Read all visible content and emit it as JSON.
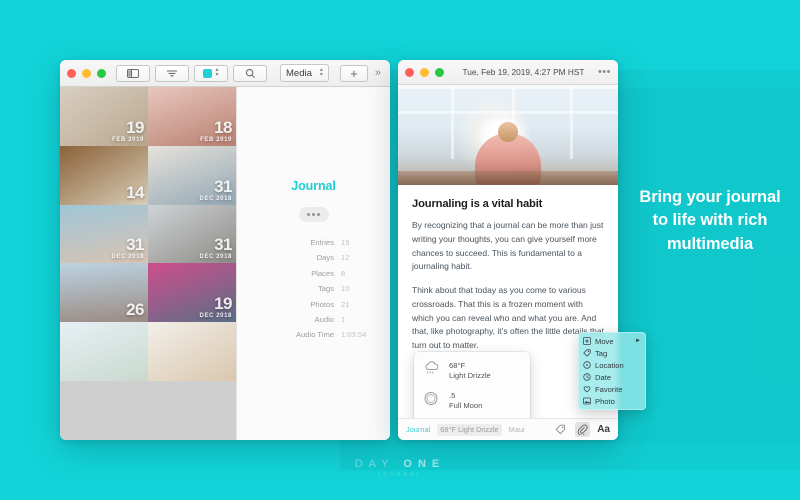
{
  "backdrop": {
    "accent_color": "#12d4d8",
    "marketing_text": "Bring your journal to life with rich multimedia",
    "watermark_main": "DAY ONE",
    "watermark_sub": "JOURNAL"
  },
  "media_window": {
    "toolbar": {
      "sidebar_toggle_icon": "sidebar-toggle-icon",
      "filter_icon": "filter-icon",
      "color_swatch_color": "#22cfd4",
      "search_icon": "search-icon",
      "select_value": "Media",
      "add_label": "+",
      "overflow_label": "»"
    },
    "grid_tiles": [
      {
        "day": "19",
        "month": "FEB 2019",
        "show_badge": true,
        "bg": "linear-gradient(145deg,#d8cfc0,#b9a78e)"
      },
      {
        "day": "18",
        "month": "FEB 2019",
        "show_badge": true,
        "bg": "linear-gradient(160deg,#e8c7bd,#b98071)"
      },
      {
        "day": "14",
        "month": "",
        "show_badge": true,
        "bg": "linear-gradient(150deg,#8a6238,#d9cdb8)"
      },
      {
        "day": "31",
        "month": "DEC 2018",
        "show_badge": true,
        "bg": "linear-gradient(160deg,#e6e2da,#93a7b4)"
      },
      {
        "day": "31",
        "month": "DEC 2018",
        "show_badge": true,
        "bg": "linear-gradient(170deg,#9fc6d8,#d8c3b2)"
      },
      {
        "day": "31",
        "month": "DEC 2018",
        "show_badge": true,
        "bg": "linear-gradient(150deg,#cfd3d6,#8d8b86)"
      },
      {
        "day": "26",
        "month": "",
        "show_badge": true,
        "bg": "linear-gradient(175deg,#bcd3e2,#9b8b83)"
      },
      {
        "day": "19",
        "month": "DEC 2018",
        "show_badge": true,
        "bg": "linear-gradient(160deg,#cf4d8e,#5a6f86)"
      },
      {
        "day": "",
        "month": "",
        "show_badge": false,
        "bg": "linear-gradient(160deg,#e6f0f4,#c9d9cf)"
      },
      {
        "day": "",
        "month": "",
        "show_badge": false,
        "bg": "linear-gradient(150deg,#f2efe9,#d9c7ad)"
      }
    ],
    "detail": {
      "journal_title": "Journal",
      "more_button_label": "•••",
      "stats": [
        {
          "key": "Entries",
          "value": "19"
        },
        {
          "key": "Days",
          "value": "12"
        },
        {
          "key": "Places",
          "value": "8"
        },
        {
          "key": "Tags",
          "value": "10"
        },
        {
          "key": "Photos",
          "value": "21"
        },
        {
          "key": "Audio",
          "value": "1"
        },
        {
          "key": "Audio Time",
          "value": "1:03:54"
        }
      ]
    }
  },
  "entry_window": {
    "date": "Tue, Feb 19, 2019, 4:27 PM HST",
    "more_label": "•••",
    "title": "Journaling is a vital habit",
    "paragraph_1": "By recognizing that a journal can be more than just writing your thoughts, you can give yourself more chances to succeed. This is fundamental to a journaling habit.",
    "paragraph_2": "Think about that today as you come to various crossroads. That this is a frozen moment with which you can reveal who and what you are. And that, like photography, it’s often the little details that turn out to matter.",
    "weather_popover": {
      "temperature": "68°F",
      "condition": "Light Drizzle",
      "moon_value": ".5",
      "moon_phase": "Full Moon"
    },
    "status_bar": {
      "journal_name": "Journal",
      "weather": "68°F Light Drizzle",
      "location": "Maui",
      "tag_icon": "tag-icon",
      "attachment_icon": "paperclip-icon",
      "format_label": "Aa"
    }
  },
  "context_menu": {
    "items": [
      {
        "label": "Move",
        "icon": "move-icon",
        "has_submenu": true
      },
      {
        "label": "Tag",
        "icon": "tag-icon",
        "has_submenu": false
      },
      {
        "label": "Location",
        "icon": "location-icon",
        "has_submenu": false
      },
      {
        "label": "Date",
        "icon": "clock-icon",
        "has_submenu": false
      },
      {
        "label": "Favorite",
        "icon": "heart-icon",
        "has_submenu": false
      },
      {
        "label": "Photo",
        "icon": "photo-icon",
        "has_submenu": false
      }
    ]
  }
}
